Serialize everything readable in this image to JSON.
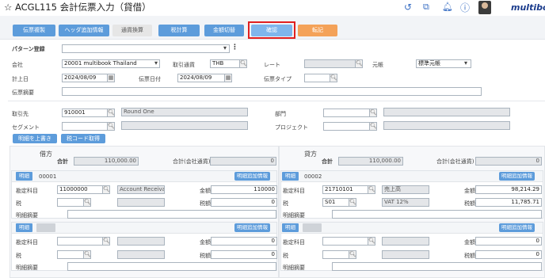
{
  "header": {
    "title": "ACGL115 会計伝票入力（貸借）",
    "star": "☆",
    "logo": "multibook"
  },
  "toolbar": [
    {
      "label": "伝票複製",
      "style": "blue"
    },
    {
      "label": "ヘッダ追加情報",
      "style": "blue"
    },
    {
      "label": "通貨換算",
      "style": "gray"
    },
    {
      "label": "税計算",
      "style": "blue"
    },
    {
      "label": "金額切替",
      "style": "blue"
    },
    {
      "label": "確認",
      "style": "sel"
    },
    {
      "label": "転記",
      "style": "orange"
    }
  ],
  "form": {
    "pattern_label": "パターン登録",
    "company_label": "会社",
    "company_value": "20001 multibook Thailand",
    "currency_label": "取引通貨",
    "currency_value": "THB",
    "rate_label": "レート",
    "ledger_label": "元帳",
    "ledger_value": "標準元帳",
    "post_date_label": "計上日",
    "post_date_value": "2024/08/09",
    "slip_date_label": "伝票日付",
    "slip_date_value": "2024/08/09",
    "slip_type_label": "伝票タイプ",
    "summary_label": "伝票摘要",
    "partner_label": "取引先",
    "partner_code": "910001",
    "partner_name": "Round One",
    "dept_label": "部門",
    "segment_label": "セグメント",
    "project_label": "プロジェクト",
    "copy_detail_button": "明細を上書き",
    "tax_code_button": "税コード取得"
  },
  "debit": {
    "side_label": "借方",
    "total_label": "合計",
    "total_value": "110,000.00",
    "company_total_label": "合計(会社通貨)",
    "company_total_value": "0",
    "line1": {
      "tag": "明細",
      "no": "00001",
      "add_label": "明細追加情報",
      "account_label": "勘定科目",
      "account_code": "11000000",
      "account_name": "Account Receiva",
      "amount_label": "金額",
      "amount_value": "110000",
      "tax_label": "税",
      "tax_amount_label": "税額",
      "tax_amount_value": "0",
      "memo_label": "明細摘要"
    },
    "line2": {
      "tag": "明細",
      "add_label": "明細追加情報",
      "account_label": "勘定科目",
      "amount_label": "金額",
      "amount_value": "0",
      "tax_label": "税",
      "tax_amount_label": "税額",
      "tax_amount_value": "0",
      "memo_label": "明細摘要"
    }
  },
  "credit": {
    "side_label": "貸方",
    "total_label": "合計",
    "total_value": "110,000.00",
    "company_total_label": "合計(会社通貨)",
    "company_total_value": "0",
    "line1": {
      "tag": "明細",
      "no": "00002",
      "add_label": "明細追加情報",
      "account_label": "勘定科目",
      "account_code": "21710101",
      "account_name": "売上高",
      "amount_label": "金額",
      "amount_value": "98,214.29",
      "tax_label": "税",
      "tax_code": "S01",
      "tax_name": "VAT 12%",
      "tax_amount_label": "税額",
      "tax_amount_value": "11,785.71",
      "memo_label": "明細摘要"
    },
    "line2": {
      "tag": "明細",
      "add_label": "明細追加情報",
      "account_label": "勘定科目",
      "amount_label": "金額",
      "amount_value": "0",
      "tax_label": "税",
      "tax_amount_label": "税額",
      "tax_amount_value": "0",
      "memo_label": "明細摘要"
    }
  }
}
